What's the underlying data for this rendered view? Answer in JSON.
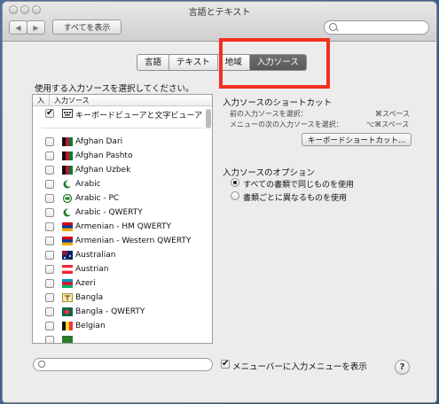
{
  "window": {
    "title": "言語とテキスト"
  },
  "toolbar": {
    "back": "◀",
    "forward": "▶",
    "show_all": "すべてを表示",
    "search_placeholder": ""
  },
  "tabs": [
    {
      "label": "言語",
      "active": false
    },
    {
      "label": "テキスト",
      "active": false
    },
    {
      "label": "地域",
      "active": false
    },
    {
      "label": "入力ソース",
      "active": true
    }
  ],
  "left": {
    "heading": "使用する入力ソースを選択してください。",
    "col_on": "入",
    "col_source": "入力ソース",
    "items": [
      {
        "label": "キーボードビューアと文字ビューア",
        "checked": true,
        "icon": "keyboard-viewer-icon"
      },
      {
        "label": "Afghan Dari",
        "checked": false,
        "icon": "afghanistan-flag-icon"
      },
      {
        "label": "Afghan Pashto",
        "checked": false,
        "icon": "afghanistan-flag-icon"
      },
      {
        "label": "Afghan Uzbek",
        "checked": false,
        "icon": "afghanistan-flag-icon"
      },
      {
        "label": "Arabic",
        "checked": false,
        "icon": "crescent-icon"
      },
      {
        "label": "Arabic - PC",
        "checked": false,
        "icon": "crescent-pc-icon"
      },
      {
        "label": "Arabic - QWERTY",
        "checked": false,
        "icon": "crescent-icon"
      },
      {
        "label": "Armenian - HM QWERTY",
        "checked": false,
        "icon": "armenia-flag-icon"
      },
      {
        "label": "Armenian - Western QWERTY",
        "checked": false,
        "icon": "armenia-flag-icon"
      },
      {
        "label": "Australian",
        "checked": false,
        "icon": "australia-flag-icon"
      },
      {
        "label": "Austrian",
        "checked": false,
        "icon": "austria-flag-icon"
      },
      {
        "label": "Azeri",
        "checked": false,
        "icon": "azerbaijan-flag-icon"
      },
      {
        "label": "Bangla",
        "checked": false,
        "icon": "bangla-icon"
      },
      {
        "label": "Bangla - QWERTY",
        "checked": false,
        "icon": "bangladesh-flag-icon"
      },
      {
        "label": "Belgian",
        "checked": false,
        "icon": "belgium-flag-icon"
      }
    ]
  },
  "shortcuts": {
    "heading": "入力ソースのショートカット",
    "prev_label": "前の入力ソースを選択：",
    "prev_key": "⌘スペース",
    "next_label": "メニューの次の入力ソースを選択：",
    "next_key": "⌥⌘スペース",
    "button": "キーボードショートカット..."
  },
  "options": {
    "heading": "入力ソースのオプション",
    "radio1": "すべての書類で同じものを使用",
    "radio2": "書類ごとに異なるものを使用",
    "selected": 1
  },
  "bottom": {
    "menu_label": "メニューバーに入力メニューを表示",
    "menu_checked": true,
    "help": "?"
  },
  "colors": {
    "highlight": "#f2301f",
    "active_tab": "#5e5e5e"
  }
}
